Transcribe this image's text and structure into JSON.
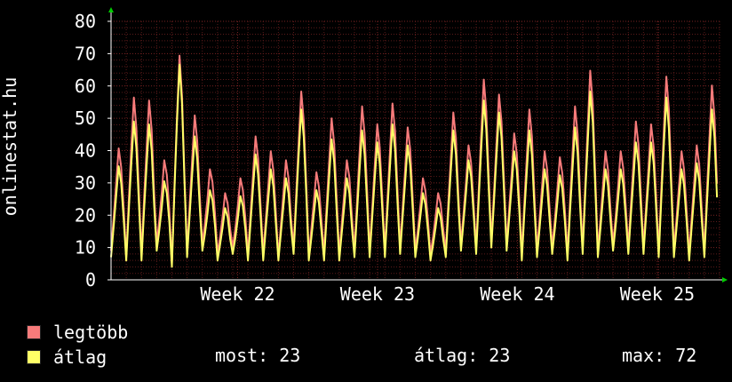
{
  "chart_data": {
    "type": "line",
    "ylabel": "onlinestat.hu",
    "ylim": [
      0,
      80
    ],
    "yticks": [
      0,
      10,
      20,
      30,
      40,
      50,
      60,
      70,
      80
    ],
    "xticks": [
      "Week 22",
      "Week 23",
      "Week 24",
      "Week 25"
    ],
    "grid": true,
    "colors": {
      "background": "#000000",
      "grid": "#5a1a1a",
      "axis": "#ffffff",
      "arrow": "#00cc00"
    },
    "series": [
      {
        "name": "legtöbb",
        "color": "#f77b7b",
        "peaks": [
          44,
          61,
          60,
          40,
          75,
          55,
          37,
          29,
          34,
          48,
          43,
          40,
          63,
          36,
          54,
          40,
          58,
          52,
          59,
          51,
          34,
          29,
          56,
          45,
          67,
          62,
          49,
          57,
          43,
          41,
          58,
          70,
          43,
          43,
          53,
          52,
          68,
          43,
          45,
          65
        ],
        "troughs": [
          9,
          7,
          8,
          11,
          5,
          9,
          11,
          8,
          10,
          8,
          8,
          7,
          10,
          8,
          8,
          8,
          9,
          9,
          9,
          10,
          9,
          8,
          9,
          11,
          10,
          12,
          11,
          8,
          9,
          10,
          8,
          10,
          9,
          11,
          10,
          10,
          9,
          9,
          8,
          9
        ]
      },
      {
        "name": "átlag",
        "color": "#ffff66",
        "peaks": [
          38,
          53,
          52,
          33,
          72,
          48,
          30,
          24,
          28,
          42,
          37,
          34,
          57,
          30,
          47,
          34,
          50,
          46,
          52,
          45,
          29,
          24,
          50,
          40,
          60,
          56,
          43,
          50,
          37,
          35,
          51,
          63,
          37,
          37,
          46,
          46,
          61,
          37,
          39,
          57
        ],
        "troughs": [
          7,
          6,
          6,
          9,
          4,
          7,
          9,
          6,
          8,
          6,
          6,
          6,
          8,
          6,
          6,
          6,
          7,
          7,
          7,
          8,
          7,
          6,
          7,
          9,
          8,
          10,
          9,
          6,
          7,
          8,
          6,
          8,
          7,
          9,
          8,
          8,
          7,
          7,
          6,
          7
        ]
      }
    ]
  },
  "legend": [
    {
      "label": "legtöbb",
      "color": "#f77b7b"
    },
    {
      "label": "átlag",
      "color": "#ffff66"
    }
  ],
  "stats": {
    "now": "most: 23",
    "avg": "átlag: 23",
    "max": "max: 72"
  }
}
